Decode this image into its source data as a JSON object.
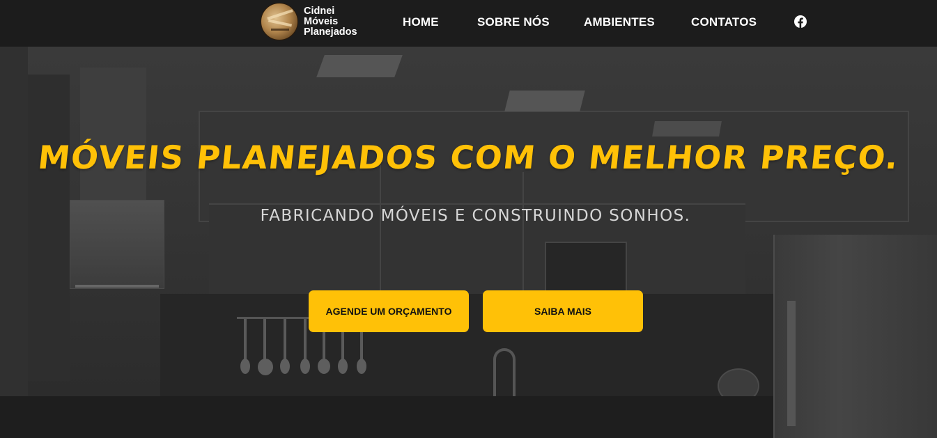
{
  "brand": {
    "name_lines": [
      "Cidnei",
      "Móveis",
      "Planejados"
    ],
    "logo_icon": "woodworking-logo"
  },
  "nav": {
    "items": [
      {
        "label": "HOME"
      },
      {
        "label": "SOBRE NÓS"
      },
      {
        "label": "AMBIENTES"
      },
      {
        "label": "CONTATOS"
      }
    ],
    "social_icon": "facebook-icon"
  },
  "hero": {
    "title": "MÓVEIS PLANEJADOS COM O MELHOR PREÇO.",
    "subtitle": "FABRICANDO MÓVEIS E CONSTRUINDO SONHOS.",
    "buttons": [
      {
        "label": "AGENDE UM ORÇAMENTO"
      },
      {
        "label": "SAIBA MAIS"
      }
    ],
    "background": "kitchen-photo"
  },
  "colors": {
    "navbar": "#1c1c1c",
    "accent": "#ffc107",
    "nav_text": "#ffffff",
    "subtitle_text": "#d6d6d6"
  }
}
